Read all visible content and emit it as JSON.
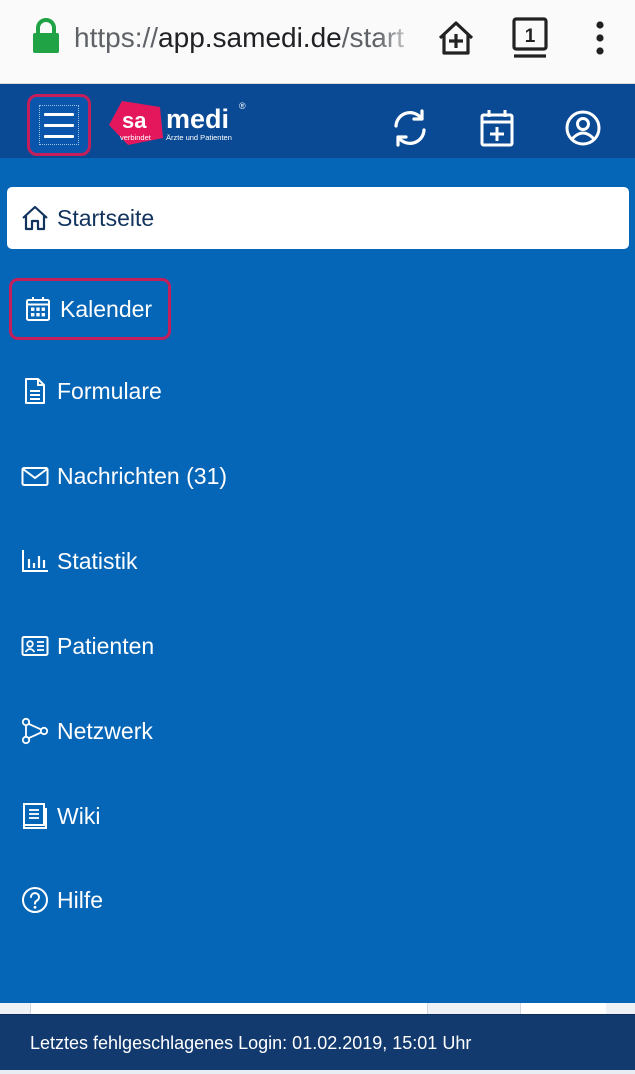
{
  "browser": {
    "url_scheme": "https://",
    "url_host": "app.samedi.de",
    "url_path": "/start",
    "tab_count": "1",
    "icons": [
      "lock-icon",
      "home-add-icon",
      "tabs-icon",
      "overflow-menu-icon"
    ]
  },
  "header": {
    "logo_sa": "sa",
    "logo_medi": "medi",
    "logo_registered": "®",
    "logo_tag_left": "verbindet",
    "logo_tag_right": "Ärzte und Patienten",
    "icons": [
      "hamburger-menu-icon",
      "sync-icon",
      "calendar-add-icon",
      "user-account-icon"
    ]
  },
  "menu": {
    "items": [
      {
        "label": "Startseite",
        "icon": "home-icon",
        "state": "active"
      },
      {
        "label": "Kalender",
        "icon": "calendar-icon",
        "state": "highlighted"
      },
      {
        "label": "Formulare",
        "icon": "document-icon"
      },
      {
        "label": "Nachrichten (31)",
        "icon": "envelope-icon"
      },
      {
        "label": "Statistik",
        "icon": "bar-chart-icon"
      },
      {
        "label": "Patienten",
        "icon": "id-card-icon"
      },
      {
        "label": "Netzwerk",
        "icon": "network-icon"
      },
      {
        "label": "Wiki",
        "icon": "book-icon"
      },
      {
        "label": "Hilfe",
        "icon": "help-icon"
      }
    ]
  },
  "footer": {
    "text": "Letztes fehlgeschlagenes Login: 01.02.2019, 15:01 Uhr"
  },
  "colors": {
    "header_bg": "#0a4a94",
    "menu_bg": "#0565b6",
    "highlight_border": "#c41e5b",
    "footer_bg": "#123a6e",
    "logo_pink": "#e5175c",
    "lock_green": "#1fa344"
  }
}
